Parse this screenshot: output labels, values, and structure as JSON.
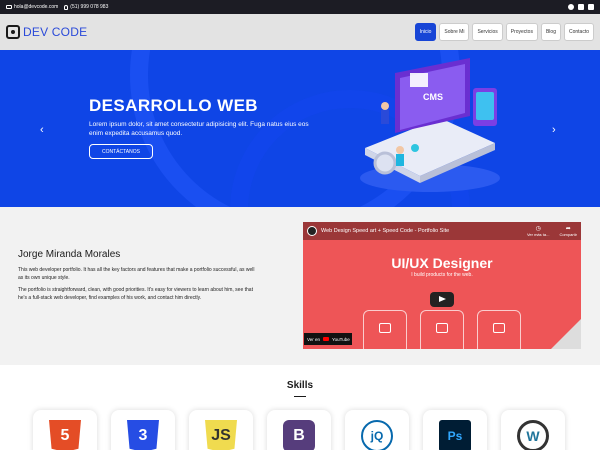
{
  "topbar": {
    "email": "hola@devcode.com",
    "phone": "(51) 999 078 983",
    "social": [
      "facebook-icon",
      "linkedin-icon",
      "instagram-icon"
    ]
  },
  "navbar": {
    "logo": "DEV CODE",
    "items": [
      "Inicio",
      "Sobre Mi",
      "Servicios",
      "Proyectos",
      "Blog",
      "Contacto"
    ],
    "active": "Inicio"
  },
  "hero": {
    "title": "DESARROLLO WEB",
    "text": "Lorem ipsum dolor, sit amet consectetur adipisicing elit. Fuga natus eius eos enim expedita accusamus quod.",
    "button": "CONTÁCTANOS",
    "illustration_text": "CMS",
    "arrow_left": "‹",
    "arrow_right": "›"
  },
  "about": {
    "name": "Jorge Miranda Morales",
    "p1": "This web developer portfolio. It has all the key factors and features that make a portfolio successful, as well as its own unique style.",
    "p2": "The portfolio is straightforward, clean, with good priorities. It's easy for viewers to learn about him, see that he's a full-stack web developer, find examples of his work, and contact him directly."
  },
  "video": {
    "title": "Web Design Speed art + Speed Code - Portfolio Site",
    "watch_later": "Ver más ta...",
    "share": "Compartir",
    "headline": "UI/UX Designer",
    "subline": "I build products for the web.",
    "watch_on": "Ver en",
    "platform": "YouTube"
  },
  "skills": {
    "title": "Skills",
    "items": [
      {
        "name": "html5-logo",
        "glyph": "5"
      },
      {
        "name": "css3-logo",
        "glyph": "3"
      },
      {
        "name": "javascript-logo",
        "glyph": "JS"
      },
      {
        "name": "bootstrap-logo",
        "glyph": "B"
      },
      {
        "name": "jquery-logo",
        "glyph": "jQ"
      },
      {
        "name": "photoshop-logo",
        "glyph": "Ps"
      },
      {
        "name": "wordpress-logo",
        "glyph": "W"
      }
    ]
  },
  "colors": {
    "brand_blue": "#0f45e6",
    "video_red": "#ee5557",
    "topbar_dark": "#1c1c24"
  }
}
